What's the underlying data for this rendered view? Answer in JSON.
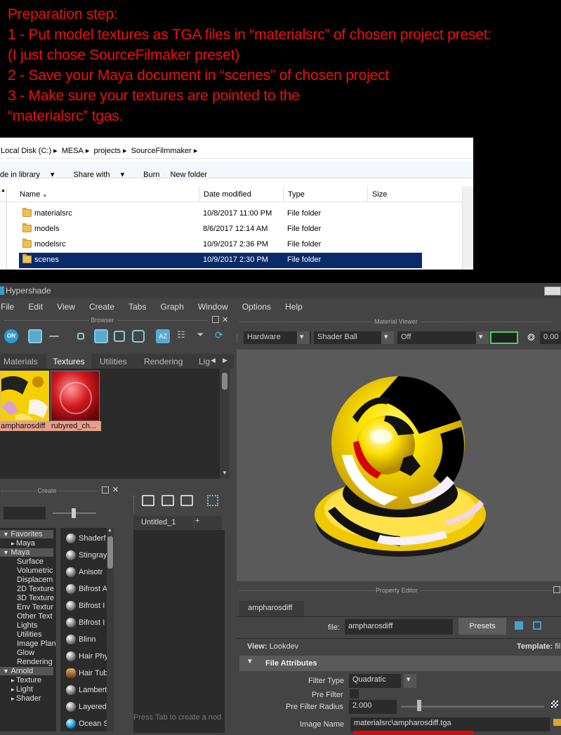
{
  "instructions": [
    "Preparation step:",
    "1 - Put model textures as TGA files in “materialsrc” of chosen project preset:",
    "(I just chose SourceFilmaker preset)",
    "2 - Save your Maya document  in “scenes” of chosen project",
    "3 - Make sure your textures are pointed to the",
    "“materialsrc” tgas."
  ],
  "explorer": {
    "breadcrumb": [
      "Local Disk (C:)",
      "MESA",
      "projects",
      "SourceFilmmaker"
    ],
    "toolbar": [
      "de in library",
      "Share with",
      "Burn",
      "New folder"
    ],
    "columns": [
      "Name",
      "Date modified",
      "Type",
      "Size"
    ],
    "rows": [
      {
        "name": "materialsrc",
        "date": "10/8/2017 11:00 PM",
        "type": "File folder"
      },
      {
        "name": "models",
        "date": "8/6/2017 12:14 AM",
        "type": "File folder"
      },
      {
        "name": "modelsrc",
        "date": "10/9/2017 2:36 PM",
        "type": "File folder"
      },
      {
        "name": "scenes",
        "date": "10/9/2017 2:30 PM",
        "type": "File folder"
      }
    ]
  },
  "hypershade": {
    "title": "Hypershade",
    "menu": [
      "File",
      "Edit",
      "View",
      "Create",
      "Tabs",
      "Graph",
      "Window",
      "Options",
      "Help"
    ],
    "browser": {
      "title": "Browser",
      "tabs": [
        "Materials",
        "Textures",
        "Utilities",
        "Rendering",
        "Lig"
      ],
      "active_tab": "Textures",
      "swatches": [
        "ampharosdiff",
        "rubyred_ch..."
      ]
    },
    "create": {
      "title": "Create",
      "tree": [
        {
          "label": "Favorites",
          "level": 0,
          "arrow": "down"
        },
        {
          "label": "Maya",
          "level": 1,
          "arrow": "right"
        },
        {
          "label": "Maya",
          "level": 0,
          "arrow": "down"
        },
        {
          "label": "Surface",
          "level": 2
        },
        {
          "label": "Volumetric",
          "level": 2
        },
        {
          "label": "Displacem",
          "level": 2
        },
        {
          "label": "2D Texture",
          "level": 2
        },
        {
          "label": "3D Texture",
          "level": 2
        },
        {
          "label": "Env Textur",
          "level": 2
        },
        {
          "label": "Other Text",
          "level": 2
        },
        {
          "label": "Lights",
          "level": 2
        },
        {
          "label": "Utilities",
          "level": 2
        },
        {
          "label": "Image Plan",
          "level": 2
        },
        {
          "label": "Glow",
          "level": 2
        },
        {
          "label": "Rendering",
          "level": 2
        },
        {
          "label": "Arnold",
          "level": 0,
          "arrow": "down"
        },
        {
          "label": "Texture",
          "level": 1,
          "arrow": "right"
        },
        {
          "label": "Light",
          "level": 1,
          "arrow": "right"
        },
        {
          "label": "Shader",
          "level": 1,
          "arrow": "right"
        }
      ],
      "nodes": [
        "Shaderf",
        "Stingray",
        "Anisotr",
        "Bifrost A",
        "Bifrost I",
        "Bifrost I",
        "Blinn",
        "Hair Phy",
        "Hair Tub",
        "Lambert",
        "Layered",
        "Ocean S"
      ]
    },
    "bins": {
      "tab": "Untitled_1",
      "add": "+",
      "hint": "Press Tab to create a nod"
    },
    "material_viewer": {
      "title": "Material Viewer",
      "renderer": "Hardware",
      "shape": "Shader Ball",
      "env": "Off",
      "exposure": "0.00"
    },
    "property_editor": {
      "title": "Property Editor",
      "node_tab": "ampharosdiff",
      "file_label": "file:",
      "file_value": "ampharosdiff",
      "presets": "Presets",
      "view_label": "View:",
      "view_value": "Lookdev",
      "template_label": "Template:",
      "template_value": "fil",
      "section": "File Attributes",
      "filter_type_label": "Filter Type",
      "filter_type_value": "Quadratic",
      "pre_filter_label": "Pre Filter",
      "pre_filter_radius_label": "Pre Filter Radius",
      "pre_filter_radius_value": "2.000",
      "image_name_label": "Image Name",
      "image_name_value": "materialsrc\\ampharosdiff.tga"
    }
  },
  "colors": {
    "instruction_text": "#ee0f0f",
    "selected_row": "#0a2b6a",
    "maya_bg": "#444444",
    "underline": "#ee0000",
    "ampharos_yellow": "#f2d400"
  }
}
